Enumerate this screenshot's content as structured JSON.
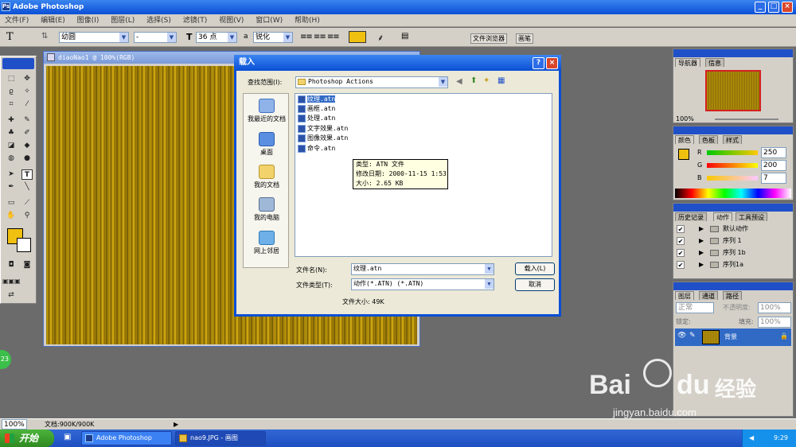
{
  "app": {
    "title": "Adobe Photoshop",
    "logo": "Ps",
    "win_min": "_",
    "win_max": "□",
    "win_close": "×"
  },
  "menu": [
    "文件(F)",
    "编辑(E)",
    "图像(I)",
    "图层(L)",
    "选择(S)",
    "滤镜(T)",
    "视图(V)",
    "窗口(W)",
    "帮助(H)"
  ],
  "options": {
    "font_family": "幼圆",
    "font_style": "-",
    "font_size": "36 点",
    "aa_label": "a",
    "aa_mode": "锐化",
    "text_color": "#f0c010",
    "palette_tabs": [
      "文件浏览器",
      "画笔"
    ]
  },
  "document": {
    "title": "diaoNao1 @ 100%(RGB)"
  },
  "dialog": {
    "title": "载入",
    "help": "?",
    "close": "×",
    "lookin_label": "查找范围(I):",
    "lookin_value": "Photoshop Actions",
    "places": [
      "我最近的文档",
      "桌面",
      "我的文档",
      "我的电脑",
      "网上邻居"
    ],
    "files": [
      "纹理.atn",
      "画框.atn",
      "处理.atn",
      "文字效果.atn",
      "图像效果.atn",
      "命令.atn"
    ],
    "tooltip": [
      "类型: ATN 文件",
      "修改日期: 2000-11-15 1:53",
      "大小: 2.65 KB"
    ],
    "filename_label": "文件名(N):",
    "filename_value": "纹理.atn",
    "filetype_label": "文件类型(T):",
    "filetype_value": "动作(*.ATN) (*.ATN)",
    "load_button": "载入(L)",
    "cancel_button": "取消",
    "filesize": "文件大小: 49K"
  },
  "panels": {
    "navigator_tabs": [
      "导航器",
      "信息"
    ],
    "nav_zoom": "100%",
    "color_tabs": [
      "颜色",
      "色板",
      "样式"
    ],
    "color_r": "250",
    "color_g": "200",
    "color_b": "7",
    "color_r_label": "R",
    "color_g_label": "G",
    "color_b_label": "B",
    "actions_tabs": [
      "历史记录",
      "动作",
      "工具预设"
    ],
    "actions": [
      "默认动作",
      "序列 1",
      "序列 1b",
      "序列1a"
    ],
    "layers_tabs": [
      "图层",
      "通道",
      "路径"
    ],
    "blend_mode": "正常",
    "opacity_label": "不透明度:",
    "opacity": "100%",
    "lock_label": "锁定:",
    "fill_label": "填充:",
    "fill": "100%",
    "layer_name": "背景"
  },
  "status": {
    "zoom": "100%",
    "doc_size": "文档:900K/900K"
  },
  "taskbar": {
    "start": "开始",
    "tasks": [
      "Adobe Photoshop",
      "nao9.JPG - 画图"
    ],
    "clock": "9:29",
    "badge": "23"
  },
  "watermark": {
    "brand": "Bai",
    "brand2": "du",
    "jingyan": "经验",
    "url": "jingyan.baidu.com"
  },
  "colors": {
    "titlebar": "#0a4fd6",
    "fg_swatch": "#f0c010",
    "accent": "#316ac5"
  }
}
